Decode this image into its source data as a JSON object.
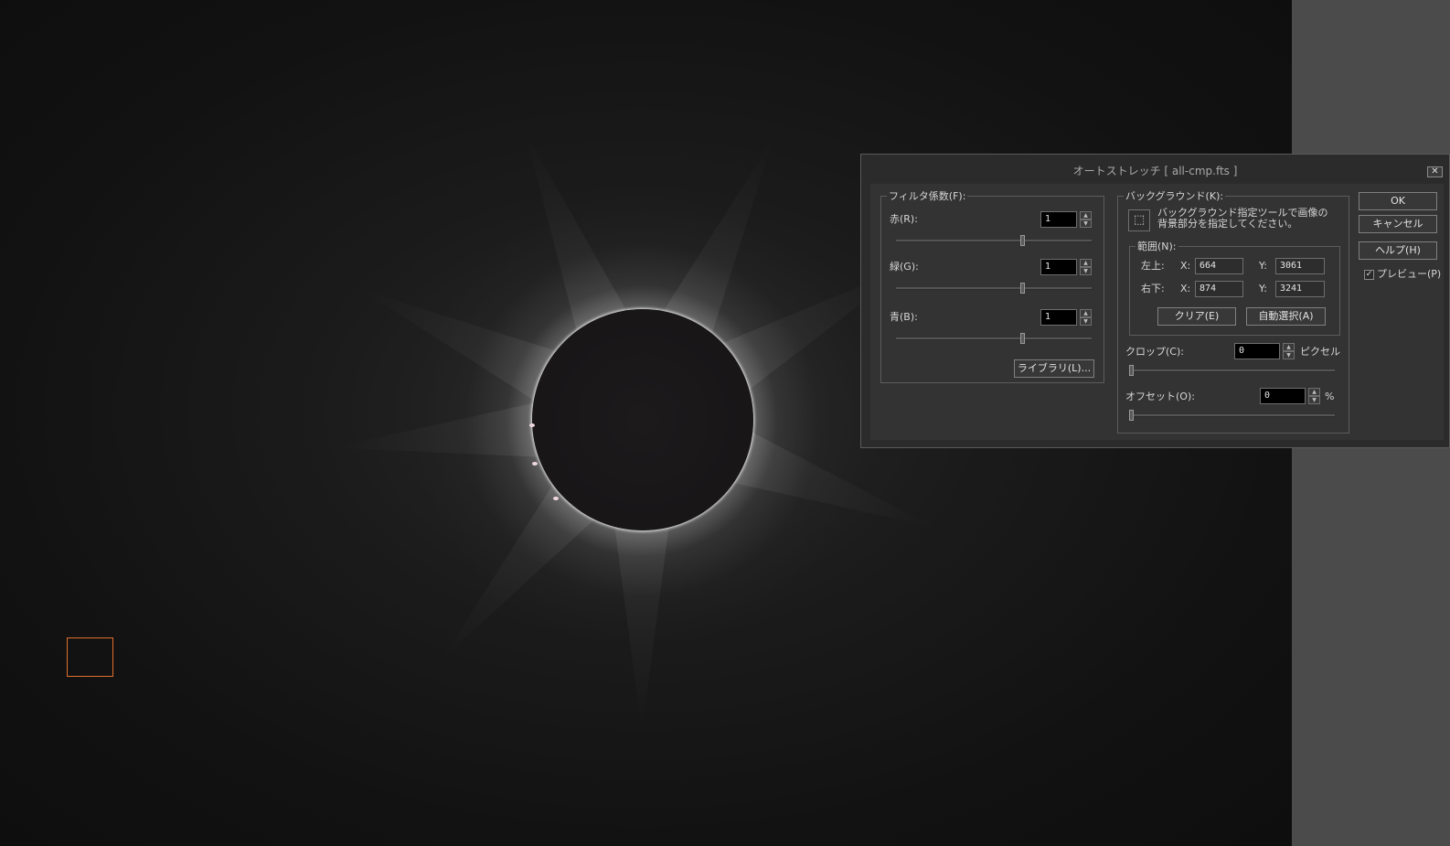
{
  "dialog": {
    "title": "オートストレッチ [ all-cmp.fts ]",
    "close_glyph": "✕",
    "filter": {
      "legend": "フィルタ係数(F):",
      "red": {
        "label": "赤(R):",
        "value": "1",
        "level": 0.65
      },
      "green": {
        "label": "緑(G):",
        "value": "1",
        "level": 0.65
      },
      "blue": {
        "label": "青(B):",
        "value": "1",
        "level": 0.65
      },
      "library_button": "ライブラリ(L)..."
    },
    "background": {
      "legend": "バックグラウンド(K):",
      "tool_icon": "select-region-icon",
      "instruction_line1": "バックグラウンド指定ツールで画像の",
      "instruction_line2": "背景部分を指定してください。",
      "range": {
        "legend": "範囲(N):",
        "top_left_label": "左上:",
        "bottom_right_label": "右下:",
        "x_label": "X:",
        "y_label": "Y:",
        "top_left_x": "664",
        "top_left_y": "3061",
        "bottom_right_x": "874",
        "bottom_right_y": "3241",
        "clear_button": "クリア(E)",
        "auto_select_button": "自動選択(A)"
      },
      "crop": {
        "label": "クロップ(C):",
        "value": "0",
        "unit": "ピクセル",
        "level": 0
      },
      "offset": {
        "label": "オフセット(O):",
        "value": "0",
        "unit": "%",
        "level": 0
      }
    },
    "buttons": {
      "ok": "OK",
      "cancel": "キャンセル",
      "help": "ヘルプ(H)"
    },
    "preview": {
      "label": "プレビュー(P)",
      "checked": true,
      "check_glyph": "✓"
    }
  },
  "image": {
    "selection_color": "#e0702c"
  },
  "spin_up": "▲",
  "spin_down": "▼"
}
